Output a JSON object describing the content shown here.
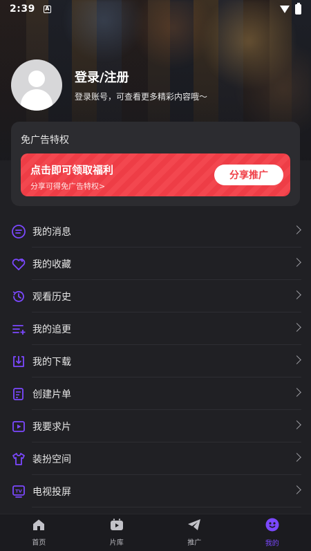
{
  "status": {
    "time": "2:39",
    "notif_glyph": "A"
  },
  "profile": {
    "login_title": "登录/注册",
    "login_sub": "登录账号，可查看更多精彩内容哦～"
  },
  "ad": {
    "title": "免广告特权",
    "banner_main": "点击即可领取福利",
    "banner_sub": "分享可得免广告特权>",
    "button": "分享推广"
  },
  "menu": {
    "items": [
      {
        "label": "我的消息",
        "icon": "message-icon"
      },
      {
        "label": "我的收藏",
        "icon": "heart-icon"
      },
      {
        "label": "观看历史",
        "icon": "history-icon"
      },
      {
        "label": "我的追更",
        "icon": "follow-list-icon"
      },
      {
        "label": "我的下载",
        "icon": "download-icon"
      },
      {
        "label": "创建片单",
        "icon": "playlist-icon"
      },
      {
        "label": "我要求片",
        "icon": "request-icon"
      },
      {
        "label": "装扮空间",
        "icon": "shirt-icon"
      },
      {
        "label": "电视投屏",
        "icon": "tv-icon"
      }
    ]
  },
  "tabbar": {
    "tabs": [
      {
        "label": "首页",
        "icon": "home-icon"
      },
      {
        "label": "片库",
        "icon": "library-icon"
      },
      {
        "label": "推广",
        "icon": "paper-plane-icon"
      },
      {
        "label": "我的",
        "icon": "profile-icon",
        "active": true
      }
    ]
  },
  "colors": {
    "accent": "#7b48ff",
    "banner_red": "#f3474f",
    "background": "#202024"
  }
}
